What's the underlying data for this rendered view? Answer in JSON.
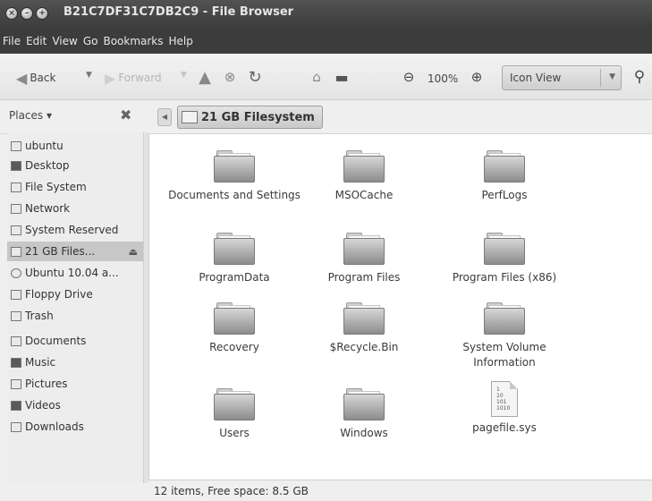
{
  "window": {
    "title": "B21C7DF31C7DB2C9 - File Browser",
    "buttons": {
      "close": "×",
      "minimize": "–",
      "maximize": "+"
    }
  },
  "menubar": {
    "items": [
      "File",
      "Edit",
      "View",
      "Go",
      "Bookmarks",
      "Help"
    ]
  },
  "toolbar": {
    "back_label": "Back",
    "forward_label": "Forward",
    "zoom_level": "100%",
    "view_mode": "Icon View"
  },
  "location": {
    "places_label": "Places ▾",
    "breadcrumb": "21 GB Filesystem"
  },
  "sidebar": {
    "items": [
      {
        "label": "ubuntu",
        "icon": "home-icon"
      },
      {
        "label": "Desktop",
        "icon": "desktop-icon"
      },
      {
        "label": "File System",
        "icon": "drive-icon"
      },
      {
        "label": "Network",
        "icon": "network-icon"
      },
      {
        "label": "System Reserved",
        "icon": "drive-icon"
      },
      {
        "label": "21 GB Files...",
        "icon": "drive-icon",
        "selected": true
      },
      {
        "label": "Ubuntu 10.04 a...",
        "icon": "cdrom-icon"
      },
      {
        "label": "Floppy Drive",
        "icon": "floppy-icon"
      },
      {
        "label": "Trash",
        "icon": "trash-icon"
      },
      {
        "label": "Documents",
        "icon": "folder-icon"
      },
      {
        "label": "Music",
        "icon": "music-icon"
      },
      {
        "label": "Pictures",
        "icon": "pictures-icon"
      },
      {
        "label": "Videos",
        "icon": "videos-icon"
      },
      {
        "label": "Downloads",
        "icon": "downloads-icon"
      }
    ]
  },
  "content": {
    "items": [
      {
        "name": "Documents and Settings",
        "type": "folder"
      },
      {
        "name": "MSOCache",
        "type": "folder"
      },
      {
        "name": "PerfLogs",
        "type": "folder"
      },
      {
        "name": "ProgramData",
        "type": "folder"
      },
      {
        "name": "Program Files",
        "type": "folder"
      },
      {
        "name": "Program Files (x86)",
        "type": "folder"
      },
      {
        "name": "Recovery",
        "type": "folder"
      },
      {
        "name": "$Recycle.Bin",
        "type": "folder"
      },
      {
        "name": "System Volume Information",
        "type": "folder"
      },
      {
        "name": "Users",
        "type": "folder"
      },
      {
        "name": "Windows",
        "type": "folder"
      },
      {
        "name": "pagefile.sys",
        "type": "file",
        "preview": "1\n10\n101\n1010"
      }
    ]
  },
  "status": {
    "text": "12 items, Free space: 8.5 GB"
  }
}
